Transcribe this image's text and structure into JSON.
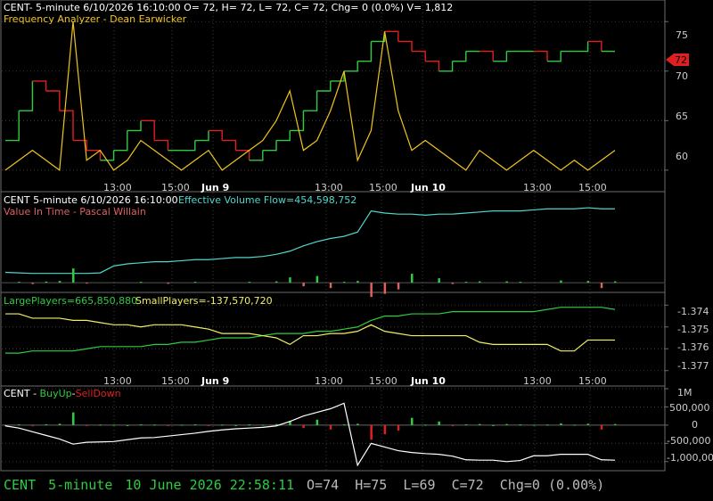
{
  "colors": {
    "background": "#000000",
    "frame": "#6b6b6b",
    "grid": "#3a3a3a",
    "price_up": "#2ecc40",
    "price_down": "#e02020",
    "oscillator": "#f0c420",
    "evf": "#4fd6cc",
    "vit_up": "#2ecc40",
    "vit_down": "#e06060",
    "large_players": "#2ecc40",
    "small_players": "#f0f060",
    "buyup_line": "#ffffff",
    "last_price_marker": "#e02020"
  },
  "panel1": {
    "header": "CENT- 5-minute 6/10/2026 16:10:00 O= 72, H= 72, L= 72, C= 72, Chg= 0 (0.0%) V= 1,812",
    "indicator": "Frequency Analyzer - Dean Earwicker",
    "price_ticks": [
      "75",
      "70",
      "65",
      "60"
    ],
    "last_price": "72"
  },
  "time_axis": {
    "labels": [
      "13:00",
      "15:00",
      "Jun 9",
      "13:00",
      "15:00",
      "Jun 10",
      "13:00",
      "15:00"
    ]
  },
  "panel2": {
    "header_left": "CENT 5-minute  6/10/2026 16:10:00",
    "header_right": "Effective Volume Flow=454,598,752",
    "indicator": "Value In Time - Pascal Willain"
  },
  "panel3": {
    "large_label": "LargePlayers=665,850,880",
    "small_label": "SmallPlayers=-137,570,720",
    "ticks": [
      "-1.374",
      "-1.375",
      "-1.376",
      "-1.377"
    ]
  },
  "panel4": {
    "prefix": "CENT - ",
    "buy": "BuyUp",
    "dash": "-",
    "sell": "SellDown",
    "ticks": [
      "1M",
      "500,000",
      "0",
      "-500,000",
      "-1,000,000"
    ]
  },
  "status_bar": {
    "symbol": "CENT",
    "interval": "5-minute",
    "datetime": "10 June 2026 22:58:11",
    "ohlc": "O=74  H=75  L=69  C=72  Chg=0 (0.00%)"
  },
  "chart_data": [
    {
      "type": "line",
      "title": "Frequency Analyzer - Dean Earwicker",
      "series": [
        {
          "values": [
            63,
            66,
            69,
            68,
            66,
            63,
            62,
            61,
            62,
            64,
            65,
            63,
            62,
            62,
            63,
            64,
            63,
            62,
            61,
            62,
            63,
            64,
            66,
            68,
            69,
            70,
            71,
            73,
            74,
            73,
            72,
            71,
            70,
            71,
            72,
            72,
            71,
            72,
            72,
            72,
            71,
            72,
            72,
            73,
            72,
            72
          ]
        }
      ],
      "oscillator": [
        60,
        61,
        62,
        61,
        60,
        75,
        61,
        62,
        60,
        61,
        63,
        62,
        61,
        60,
        61,
        62,
        60,
        61,
        62,
        63,
        65,
        68,
        62,
        63,
        66,
        70,
        61,
        64,
        74,
        66,
        62,
        63,
        62,
        61,
        60,
        62,
        61,
        60,
        61,
        62,
        61,
        60,
        61,
        60,
        61,
        62
      ],
      "ylim": [
        59,
        77
      ]
    },
    {
      "type": "line",
      "title": "Effective Volume Flow",
      "series": [
        {
          "name": "Effective Volume Flow",
          "values": [
            -0.2,
            -0.25,
            -0.3,
            -0.3,
            -0.3,
            -0.3,
            -0.3,
            -0.25,
            0.4,
            0.6,
            0.7,
            0.8,
            0.8,
            0.9,
            1.0,
            1.0,
            1.1,
            1.2,
            1.2,
            1.3,
            1.5,
            1.8,
            2.3,
            2.7,
            3.0,
            3.2,
            3.6,
            5.6,
            5.4,
            5.3,
            5.3,
            5.2,
            5.3,
            5.3,
            5.4,
            5.5,
            5.6,
            5.6,
            5.6,
            5.7,
            5.8,
            5.8,
            5.8,
            5.9,
            5.8,
            5.8
          ]
        }
      ]
    },
    {
      "type": "line",
      "title": "",
      "series": [
        {
          "name": "LargePlayers",
          "values": [
            -1.3762,
            -1.3762,
            -1.3761,
            -1.3761,
            -1.3761,
            -1.3761,
            -1.376,
            -1.3759,
            -1.3759,
            -1.3759,
            -1.3759,
            -1.3758,
            -1.3758,
            -1.3757,
            -1.3757,
            -1.3756,
            -1.3755,
            -1.3755,
            -1.3755,
            -1.3754,
            -1.3753,
            -1.3753,
            -1.3753,
            -1.3752,
            -1.3752,
            -1.3751,
            -1.375,
            -1.3747,
            -1.3745,
            -1.3745,
            -1.3744,
            -1.3744,
            -1.3744,
            -1.3743,
            -1.3743,
            -1.3743,
            -1.3743,
            -1.3743,
            -1.3743,
            -1.3743,
            -1.3742,
            -1.3741,
            -1.3741,
            -1.3741,
            -1.3741,
            -1.3742
          ]
        },
        {
          "name": "SmallPlayers",
          "values": [
            -1.3744,
            -1.3744,
            -1.3746,
            -1.3746,
            -1.3746,
            -1.3747,
            -1.3747,
            -1.3748,
            -1.3749,
            -1.3749,
            -1.375,
            -1.3749,
            -1.3749,
            -1.3749,
            -1.375,
            -1.3751,
            -1.3753,
            -1.3753,
            -1.3753,
            -1.3754,
            -1.3755,
            -1.3758,
            -1.3754,
            -1.3754,
            -1.3753,
            -1.3753,
            -1.3752,
            -1.3749,
            -1.3752,
            -1.3753,
            -1.3754,
            -1.3754,
            -1.3754,
            -1.3754,
            -1.3754,
            -1.3757,
            -1.3758,
            -1.3758,
            -1.3758,
            -1.3758,
            -1.3758,
            -1.3761,
            -1.3761,
            -1.3756,
            -1.3756,
            -1.3756
          ]
        }
      ],
      "ylim": [
        -1.3775,
        -1.3735
      ]
    },
    {
      "type": "bar",
      "title": "CENT - BuyUp-SellDown",
      "values": [
        0,
        20000,
        -30000,
        25000,
        40000,
        350000,
        -20000,
        15000,
        10000,
        0,
        20000,
        15000,
        -25000,
        10000,
        20000,
        -10000,
        15000,
        0,
        20000,
        10000,
        30000,
        120000,
        -80000,
        150000,
        -120000,
        20000,
        40000,
        -400000,
        -250000,
        -150000,
        200000,
        10000,
        100000,
        -30000,
        20000,
        30000,
        0,
        30000,
        20000,
        10000,
        15000,
        50000,
        10000,
        40000,
        -120000,
        30000
      ],
      "line": [
        -20000,
        -80000,
        -180000,
        -280000,
        -380000,
        -520000,
        -470000,
        -460000,
        -450000,
        -400000,
        -350000,
        -340000,
        -300000,
        -260000,
        -220000,
        -170000,
        -130000,
        -100000,
        -80000,
        -60000,
        -20000,
        100000,
        250000,
        350000,
        450000,
        600000,
        -1100000,
        -500000,
        -600000,
        -700000,
        -750000,
        -780000,
        -800000,
        -850000,
        -950000,
        -960000,
        -960000,
        -1000000,
        -970000,
        -840000,
        -840000,
        -800000,
        -800000,
        -800000,
        -950000,
        -960000
      ],
      "ylim": [
        -1200000,
        1000000
      ]
    }
  ]
}
